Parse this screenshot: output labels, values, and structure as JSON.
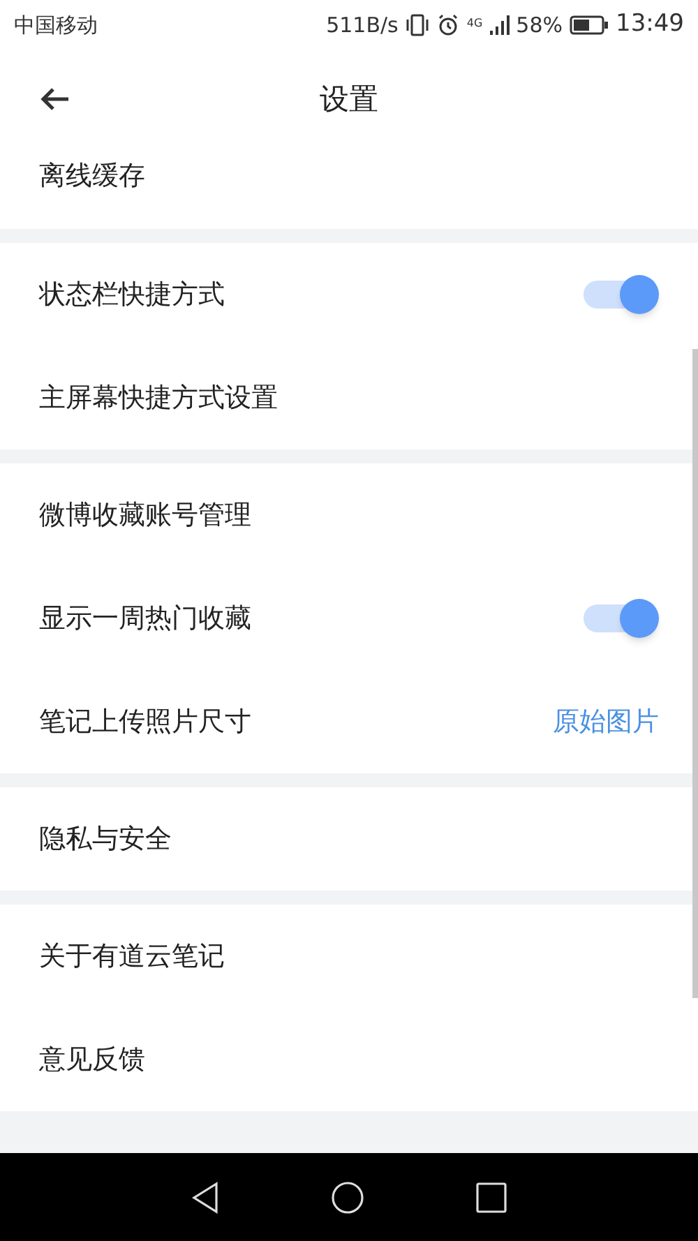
{
  "status_bar": {
    "carrier": "中国移动",
    "speed": "511B/s",
    "network": "4G",
    "battery_percent": "58%",
    "time": "13:49"
  },
  "header": {
    "title": "设置"
  },
  "sections": [
    {
      "items": [
        {
          "kind": "plain",
          "label": "离线缓存"
        }
      ]
    },
    {
      "items": [
        {
          "kind": "toggle",
          "label": "状态栏快捷方式",
          "on": true
        },
        {
          "kind": "plain",
          "label": "主屏幕快捷方式设置"
        }
      ]
    },
    {
      "items": [
        {
          "kind": "plain",
          "label": "微博收藏账号管理"
        },
        {
          "kind": "toggle",
          "label": "显示一周热门收藏",
          "on": true
        },
        {
          "kind": "value",
          "label": "笔记上传照片尺寸",
          "value": "原始图片"
        }
      ]
    },
    {
      "items": [
        {
          "kind": "plain",
          "label": "隐私与安全"
        }
      ]
    },
    {
      "items": [
        {
          "kind": "plain",
          "label": "关于有道云笔记"
        },
        {
          "kind": "plain",
          "label": "意见反馈"
        }
      ]
    }
  ]
}
